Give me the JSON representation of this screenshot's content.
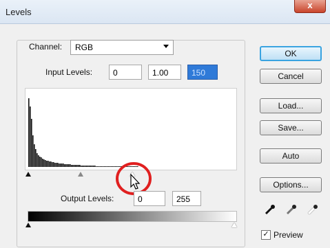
{
  "window": {
    "title": "Levels",
    "close_glyph": "x"
  },
  "channel": {
    "label": "Channel:",
    "value": "RGB"
  },
  "input_levels": {
    "label": "Input Levels:",
    "black": "0",
    "gamma": "1.00",
    "white": "150"
  },
  "output_levels": {
    "label": "Output Levels:",
    "black": "0",
    "white": "255"
  },
  "buttons": {
    "ok": "OK",
    "cancel": "Cancel",
    "load": "Load...",
    "save": "Save...",
    "auto": "Auto",
    "options": "Options..."
  },
  "preview": {
    "label": "Preview",
    "checked": true,
    "check_glyph": "✓"
  },
  "histogram": {
    "levels": [
      100,
      88,
      70,
      46,
      33,
      26,
      20,
      17,
      15,
      14,
      12,
      11,
      10,
      9,
      9,
      8,
      8,
      7,
      7,
      6,
      6,
      6,
      5,
      5,
      5,
      5,
      4,
      4,
      4,
      4,
      4,
      3,
      3,
      3,
      3,
      3,
      3,
      3,
      2,
      2,
      2,
      2,
      2,
      2,
      2,
      2,
      2,
      2,
      2,
      1,
      1,
      1,
      1,
      1,
      1,
      1,
      1,
      1,
      1,
      1,
      1,
      1,
      1,
      1,
      1,
      1,
      1,
      1,
      1,
      1,
      1,
      1,
      1,
      1,
      1,
      1,
      1,
      1,
      1,
      1
    ]
  },
  "eyedroppers": [
    "eyedropper-black-icon",
    "eyedropper-gray-icon",
    "eyedropper-white-icon"
  ],
  "highlight_color": "#e02020",
  "selection_color": "#2f7ad8"
}
